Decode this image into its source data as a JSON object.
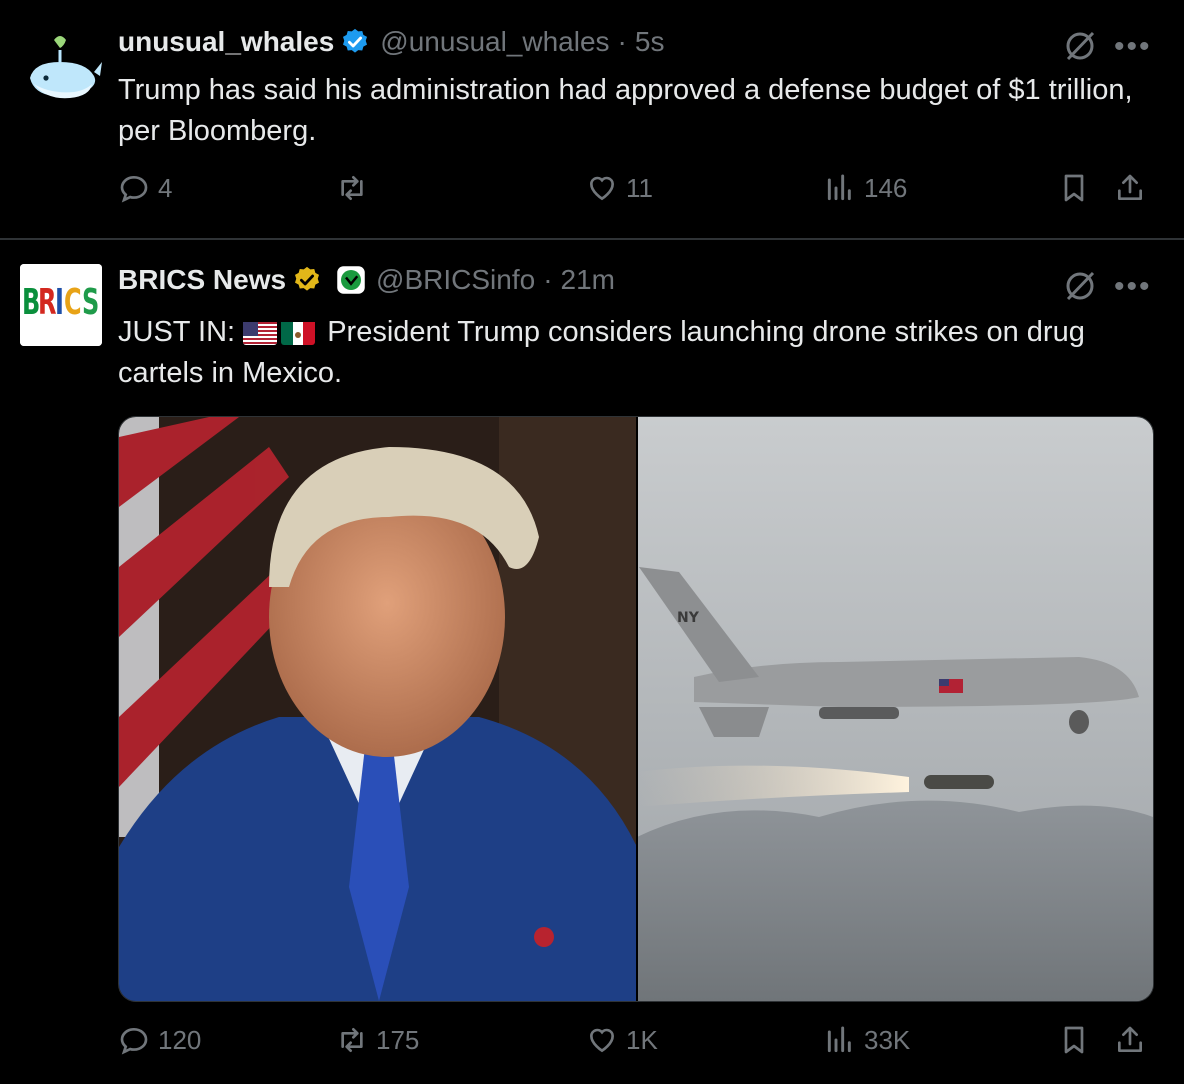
{
  "tweets": [
    {
      "author_name": "unusual_whales",
      "handle": "@unusual_whales",
      "separator": "·",
      "time": "5s",
      "text": "Trump has said his administration had approved a defense budget of $1 trillion, per Bloomberg.",
      "replies": "4",
      "reposts": "",
      "likes": "11",
      "views": "146"
    },
    {
      "author_name": "BRICS News",
      "handle": "@BRICSinfo",
      "separator": "·",
      "time": "21m",
      "text_prefix": "JUST IN:",
      "text": "President Trump considers launching drone strikes on drug cartels in Mexico.",
      "avatar_logo": "BRICS",
      "flag_icons": [
        "us-flag-icon",
        "mexico-flag-icon"
      ],
      "replies": "120",
      "reposts": "175",
      "likes": "1K",
      "views": "33K",
      "drone_tail_text": "NY"
    }
  ],
  "icons": [
    "verified-badge-icon",
    "grok-icon",
    "more-icon",
    "reply-icon",
    "repost-icon",
    "like-icon",
    "views-icon",
    "bookmark-icon",
    "share-icon"
  ],
  "colors": {
    "background": "#000000",
    "text": "#e7e9ea",
    "muted": "#71767b",
    "verified_blue": "#1d9bf0",
    "verified_gold": "#e2b719",
    "divider": "#2f3336"
  }
}
